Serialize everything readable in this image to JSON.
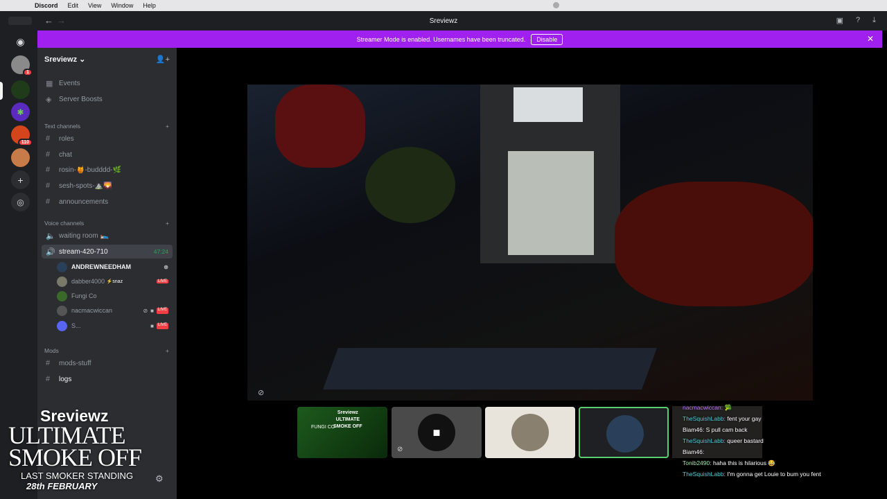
{
  "menubar": {
    "apple": "",
    "app": "Discord",
    "items": [
      "Edit",
      "View",
      "Window",
      "Help"
    ]
  },
  "titlebar": {
    "title": "Sreviewz",
    "back": "←",
    "forward": "→"
  },
  "banner": {
    "text": "Streamer Mode is enabled. Usernames have been truncated.",
    "button": "Disable",
    "close": "✕"
  },
  "server": {
    "name": "Sreviewz ⌄",
    "invite_icon": "add-person-icon"
  },
  "guild_badges": {
    "first": "1",
    "fifth": "110"
  },
  "nav": [
    {
      "label": "Events",
      "icon": "calendar-icon"
    },
    {
      "label": "Server Boosts",
      "icon": "boost-icon"
    }
  ],
  "categories": {
    "text": "Text channels",
    "voice": "Voice channels",
    "mods": "Mods"
  },
  "text_channels": [
    "roles",
    "chat",
    "rosin-🍯-budddd-🌿",
    "sesh-spots-⛰️🌄",
    "announcements"
  ],
  "voice_channels": [
    {
      "label": "waiting room 🛌"
    },
    {
      "label": "stream-420-710",
      "timer": "47:24"
    }
  ],
  "members": [
    {
      "name": "ANDREWNEEDHAM",
      "tag": ""
    },
    {
      "name": "dabber4000",
      "tag": "⚡snaz"
    },
    {
      "name": "Fungi Co",
      "tag": ""
    },
    {
      "name": "nacmacwiccan",
      "tag": ""
    },
    {
      "name": "S...",
      "tag": ""
    }
  ],
  "mod_channels": [
    "mods-stuff",
    "logs"
  ],
  "live_label": "LIVE",
  "overlay": {
    "name": "Sreviewz",
    "title_line1": "ULTIMATE",
    "title_line2": "SMOKE OFF",
    "sub": "LAST SMOKER STANDING",
    "date": "28th FEBRUARY"
  },
  "thumb1": {
    "line1": "Sreviewz",
    "line2": "ULTIMATE",
    "line3": "SMOKE OFF",
    "brand": "FUNGI CO"
  },
  "chat": [
    {
      "user": "nacmacwiccan:",
      "msg": "🥦",
      "color": "u1"
    },
    {
      "user": "TheSquishLabb:",
      "msg": "fent your gay",
      "color": "u2"
    },
    {
      "user": "Biam46:",
      "msg": "S pull cam back",
      "color": "u3"
    },
    {
      "user": "TheSquishLabb:",
      "msg": "queer bastard",
      "color": "u2"
    },
    {
      "user": "Biam46:",
      "msg": "",
      "color": "u3"
    },
    {
      "user": "Tonib2490:",
      "msg": "haha this is hilarious 😂",
      "color": "u4"
    },
    {
      "user": "TheSquishLabb:",
      "msg": "I'm gonna get Louie to bum you fent",
      "color": "u2"
    }
  ]
}
